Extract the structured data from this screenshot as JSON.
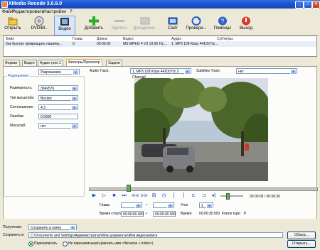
{
  "window": {
    "title": "XMedia Recode 3.0.9.0"
  },
  "menu": [
    "Файл",
    "Редактировать",
    "Настройки",
    "?"
  ],
  "toolbar": [
    {
      "label": "Открыть",
      "icon": "folder-icon"
    },
    {
      "label": "DVD/Bl..",
      "icon": "dvd-icon"
    },
    {
      "label": "Видео",
      "icon": "video-icon"
    },
    {
      "label": "Добавить",
      "icon": "add-icon"
    },
    {
      "label": "Удалить",
      "icon": "remove-icon"
    },
    {
      "label": "Докодиров..",
      "icon": "encode-icon"
    },
    {
      "label": "Сайт",
      "icon": "site-icon"
    },
    {
      "label": "Провери...",
      "icon": "check-icon"
    },
    {
      "label": "Помощь!",
      "icon": "help-icon"
    },
    {
      "label": "Выход",
      "icon": "exit-icon"
    }
  ],
  "filetable": {
    "headers": [
      "Файл",
      "Главы",
      "Длина",
      "Видео",
      "Аудио",
      "Субтитры"
    ],
    "rows": [
      [
        "Как быстро превращать нашему...",
        "0",
        "00:00:30",
        "MS MPEG 4 V3 10:00 Hz,...",
        "1. MP3 128 Kbps 44100 Hz...",
        ""
      ]
    ]
  },
  "tabs": [
    "Формат",
    "Видео",
    "Аудио трек 1",
    "Фильтры/Просмотр",
    "Задачи"
  ],
  "active_tab": "Фильтры/Просмотр",
  "filter_select": "Разрешение",
  "audio_track": {
    "label": "Audio Track:",
    "value": "1. MP3 128 Kbps 44100 Hz 2 Channel"
  },
  "subtitle_track": {
    "label": "Subtitles Track:",
    "value": "нет"
  },
  "resolution": {
    "legend": "Разрешение",
    "fields": [
      {
        "label": "Размерность:",
        "value": "304x576",
        "type": "combo"
      },
      {
        "label": "Тип масштаба:",
        "value": "Bicubic",
        "type": "combo"
      },
      {
        "label": "Соотношение:",
        "value": "4:3",
        "type": "combo"
      },
      {
        "label": "Ошибки:",
        "value": "0.0000",
        "type": "field"
      },
      {
        "label": "Масштаб:",
        "value": "нет",
        "type": "combo"
      }
    ]
  },
  "player": {
    "time": "00:00:05 / 00:00:30"
  },
  "trim": {
    "chapters_label": "Главы",
    "chapter_from": "",
    "chapter_to": "",
    "angle_label": "Угол",
    "angle_value": "1",
    "start_label": "Время старта",
    "start_value": "00:00:00.000",
    "end_value": "00:00:30.500",
    "time_label": "Время:",
    "time_value": "00:00:30.500",
    "frame_label": "Frame type:",
    "frame_value": "P"
  },
  "bottom": {
    "output_label": "Получение:",
    "output_value": "Сохранить в папку",
    "save_label": "Сохранить в:",
    "save_path": "C:\\Documents and Settings\\Администратор\\Мои документы\\Мои видеозаписи",
    "browse": "Обзор...",
    "open": "Открыть...",
    "radio_overwrite": "Перезаписать",
    "radio_rename": "Не перезаписывать(менять имя <filename + index>)"
  },
  "colors": {
    "title_bar": "#1c4fc9",
    "accent": "#e8a040"
  }
}
